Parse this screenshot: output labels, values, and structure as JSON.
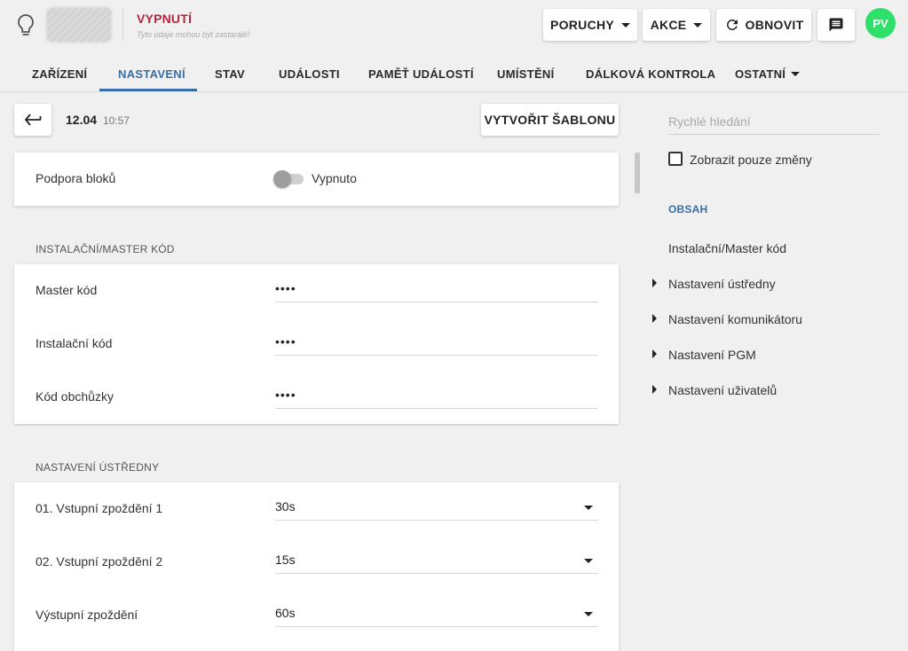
{
  "header": {
    "status_title": "VYPNUTÍ",
    "status_subtitle": "Tyto údaje mohou být zastaralé!",
    "buttons": {
      "faults": "PORUCHY",
      "actions": "AKCE",
      "refresh": "OBNOVIT"
    },
    "avatar_initials": "PV",
    "colors": {
      "status": "#b5243b",
      "accent": "#3a6ea5",
      "avatar": "#2ee06a"
    }
  },
  "tabs": [
    {
      "label": "ZAŘÍZENÍ"
    },
    {
      "label": "NASTAVENÍ",
      "active": true
    },
    {
      "label": "STAV"
    },
    {
      "label": "UDÁLOSTI"
    },
    {
      "label": "PAMĚŤ UDÁLOSTÍ"
    },
    {
      "label": "UMÍSTĚNÍ"
    },
    {
      "label": "DÁLKOVÁ KONTROLA"
    },
    {
      "label": "OSTATNÍ"
    }
  ],
  "toolbar": {
    "date": "12.04",
    "time": "10:57",
    "create_template_label": "VYTVOŘIT ŠABLONU"
  },
  "block_support": {
    "label": "Podpora bloků",
    "value_label": "Vypnuto",
    "enabled": false
  },
  "sections": {
    "codes": {
      "title": "INSTALAČNÍ/MASTER KÓD",
      "rows": [
        {
          "label": "Master kód",
          "value": "••••"
        },
        {
          "label": "Instalační kód",
          "value": "••••"
        },
        {
          "label": "Kód obchůzky",
          "value": "••••"
        }
      ]
    },
    "panel": {
      "title": "NASTAVENÍ ÚSTŘEDNY",
      "rows": [
        {
          "label": "01. Vstupní zpoždění 1",
          "value": "30s"
        },
        {
          "label": "02. Vstupní zpoždění 2",
          "value": "15s"
        },
        {
          "label": "Výstupní zpoždění",
          "value": "60s"
        }
      ]
    }
  },
  "sidebar": {
    "search_placeholder": "Rychlé hledání",
    "show_changes_label": "Zobrazit pouze změny",
    "toc_title": "OBSAH",
    "toc_items": [
      {
        "label": "Instalační/Master kód",
        "expandable": false
      },
      {
        "label": "Nastavení ústředny",
        "expandable": true
      },
      {
        "label": "Nastavení komunikátoru",
        "expandable": true
      },
      {
        "label": "Nastavení PGM",
        "expandable": true
      },
      {
        "label": "Nastavení uživatelů",
        "expandable": true
      }
    ]
  }
}
